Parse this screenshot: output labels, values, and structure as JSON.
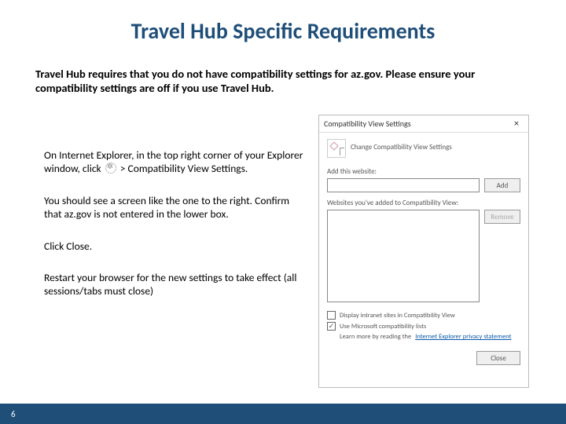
{
  "title": "Travel Hub Specific Requirements",
  "lead": "Travel Hub requires that you do not have compatibility settings for az.gov.  Please ensure your compatibility settings are off if you use Travel Hub.",
  "steps": {
    "s1a": "On Internet Explorer,  in the top right corner of your Explorer window, click ",
    "s1b": " > Compatibility View Settings.",
    "s2": "You should see a screen like the one to the right.  Confirm that az.gov is not entered in the lower box.",
    "s3": "Click Close.",
    "s4": "Restart your browser for the new settings to take effect (all sessions/tabs must close)"
  },
  "dialog": {
    "winTitle": "Compatibility View Settings",
    "header": "Change Compatibility View Settings",
    "addLabel": "Add this website:",
    "addInput": "",
    "addBtn": "Add",
    "listLabel": "Websites you've added to Compatibility View:",
    "removeBtn": "Remove",
    "chk1": "Display intranet sites in Compatibility View",
    "chk1Checked": false,
    "chk2": "Use Microsoft compatibility lists",
    "chk2Checked": true,
    "learnPrefix": "Learn more by reading the ",
    "learnLink": "Internet Explorer privacy statement",
    "closeBtn": "Close"
  },
  "pageNum": "6"
}
